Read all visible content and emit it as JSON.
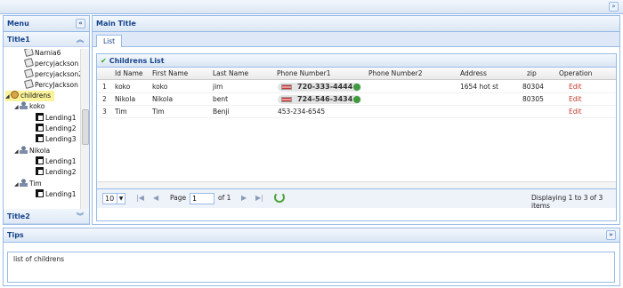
{
  "topbar": {
    "collapse_icon": "double-chevron-down-icon"
  },
  "menu": {
    "title": "Menu",
    "collapse_icon": "double-chevron-left-icon",
    "section1_title": "Title1",
    "section2_title": "Title2",
    "tree": [
      {
        "label": "Narnia6",
        "icon": "document-icon"
      },
      {
        "label": "percyjackson",
        "icon": "document-icon"
      },
      {
        "label": "percyjackson2",
        "icon": "document-icon"
      },
      {
        "label": "PercyJackson",
        "icon": "document-icon"
      },
      {
        "label": "childrens",
        "icon": "folder-icon",
        "selected": true
      },
      {
        "label": "koko",
        "icon": "user-icon"
      },
      {
        "label": "Lending1",
        "icon": "lending-icon"
      },
      {
        "label": "Lending2",
        "icon": "lending-icon"
      },
      {
        "label": "Lending3",
        "icon": "lending-icon"
      },
      {
        "label": "Nikola",
        "icon": "user-icon"
      },
      {
        "label": "Lending1",
        "icon": "lending-icon"
      },
      {
        "label": "Lending2",
        "icon": "lending-icon"
      },
      {
        "label": "Tim",
        "icon": "user-icon"
      },
      {
        "label": "Lending1",
        "icon": "lending-icon"
      }
    ],
    "hscroll_label": "ııı"
  },
  "main": {
    "title": "Main Title",
    "tab": "List",
    "grid": {
      "title": "Childrens List",
      "columns": [
        "Id Name",
        "First Name",
        "Last Name",
        "Phone Number1",
        "Phone Number2",
        "Address",
        "zip",
        "Operation"
      ],
      "rows": [
        {
          "num": "1",
          "id": "koko",
          "first": "koko",
          "last": "jim",
          "phone1": "720-333-4444",
          "phone1_badge": true,
          "phone2": "",
          "address": "1654 hot st",
          "zip": "80304",
          "op": "Edit"
        },
        {
          "num": "2",
          "id": "Nikola",
          "first": "Nikola",
          "last": "bent",
          "phone1": "724-546-3434",
          "phone1_badge": true,
          "phone2": "",
          "address": "",
          "zip": "80305",
          "op": "Edit"
        },
        {
          "num": "3",
          "id": "Tim",
          "first": "Tim",
          "last": "Benji",
          "phone1": "453-234-6545",
          "phone1_badge": false,
          "phone2": "",
          "address": "",
          "zip": "",
          "op": "Edit"
        }
      ]
    },
    "pager": {
      "page_size": "10",
      "page_label": "Page",
      "page_value": "1",
      "of_label": "of 1",
      "display_text": "Displaying 1 to 3 of 3 items"
    }
  },
  "tips": {
    "title": "Tips",
    "body": "list of childrens"
  },
  "colors": {
    "border": "#99bbe8",
    "title_text": "#15428b",
    "edit_link": "#c0392b",
    "selected_node": "#fbf39b"
  }
}
